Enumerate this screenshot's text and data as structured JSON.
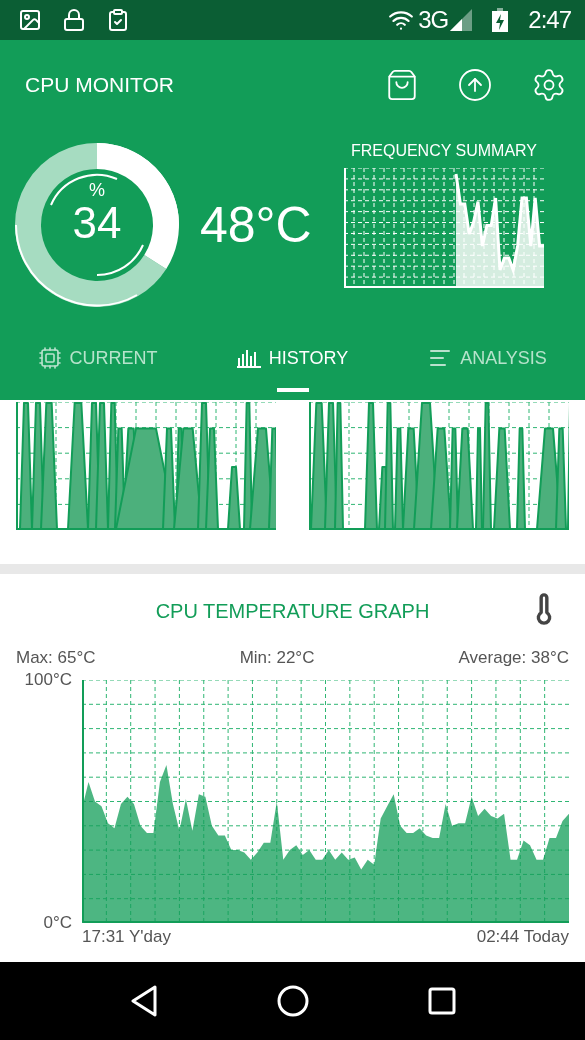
{
  "status_bar": {
    "network": "3G",
    "time": "2:47"
  },
  "app_bar": {
    "title": "CPU MONITOR"
  },
  "usage": {
    "symbol": "%",
    "value": "34"
  },
  "temperature": "48°C",
  "frequency_summary": {
    "title": "FREQUENCY SUMMARY"
  },
  "tabs": [
    {
      "label": "CURRENT",
      "selected": false
    },
    {
      "label": "HISTORY",
      "selected": true
    },
    {
      "label": "ANALYSIS",
      "selected": false
    }
  ],
  "temperature_card": {
    "title": "CPU TEMPERATURE GRAPH",
    "stats": [
      "Max: 65°C",
      "Min: 22°C",
      "Average: 38°C"
    ],
    "x_start_label": "17:31 Y'day",
    "x_end_label": "02:44 Today",
    "chart_data": {
      "type": "area",
      "grid": true,
      "ylim": [
        0,
        100
      ],
      "yticks": [
        {
          "value": 0,
          "label": "0°C"
        },
        {
          "value": 100,
          "label": "100°C"
        }
      ],
      "series": [
        {
          "color": "#129d58",
          "values": [
            47,
            58,
            50,
            48,
            41,
            39,
            49,
            52,
            49,
            40,
            37,
            37,
            58,
            65,
            49,
            38,
            51,
            38,
            53,
            52,
            40,
            36,
            36,
            30,
            30,
            29,
            26,
            29,
            33,
            33,
            50,
            26,
            30,
            32,
            28,
            30,
            26,
            26,
            30,
            26,
            29,
            26,
            27,
            22,
            26,
            24,
            43,
            48,
            53,
            40,
            37,
            37,
            39,
            36,
            35,
            35,
            49,
            40,
            41,
            41,
            52,
            44,
            47,
            44,
            43,
            45,
            26,
            26,
            34,
            32,
            26,
            26,
            35,
            35,
            42,
            45
          ]
        }
      ]
    }
  }
}
